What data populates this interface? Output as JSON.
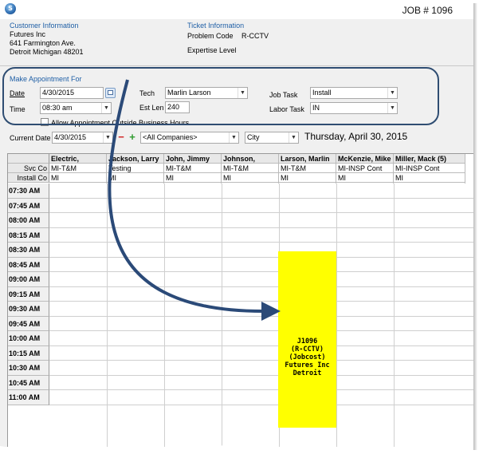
{
  "window": {
    "title": "JOB # 1096",
    "app_icon_letter": "S"
  },
  "customer": {
    "heading": "Customer Information",
    "name": "Futures  Inc",
    "address1": "641 Farmington Ave.",
    "address2": "Detroit Michigan 48201"
  },
  "ticket": {
    "heading": "Ticket Information",
    "problem_code_label": "Problem Code",
    "problem_code": "R-CCTV",
    "expertise_label": "Expertise Level"
  },
  "appointment": {
    "heading": "Make Appointment For",
    "date_label": "Date",
    "date_value": "4/30/2015",
    "time_label": "Time",
    "time_value": "08:30 am",
    "tech_label": "Tech",
    "tech_value": "Marlin Larson",
    "estlen_label": "Est Len",
    "estlen_value": "240",
    "jobtask_label": "Job Task",
    "jobtask_value": "Install",
    "labortask_label": "Labor Task",
    "labortask_value": "IN",
    "allow_outside_label": "Allow Appointment Outside Business Hours"
  },
  "toolbar": {
    "current_date_label": "Current Date",
    "current_date_value": "4/30/2015",
    "minus_label": "−",
    "plus_label": "+",
    "companies_value": "<All Companies>",
    "city_value": "City",
    "date_heading": "Thursday, April 30, 2015"
  },
  "grid": {
    "row_labels": {
      "svc": "Svc Co",
      "install": "Install Co"
    },
    "techs": [
      {
        "name": "Electric,",
        "svc": "MI-T&M",
        "install": "MI"
      },
      {
        "name": "Jackson, Larry",
        "svc": "Testing",
        "install": "MI"
      },
      {
        "name": "John, Jimmy",
        "svc": "MI-T&M",
        "install": "MI"
      },
      {
        "name": "Johnson,",
        "svc": "MI-T&M",
        "install": "MI"
      },
      {
        "name": "Larson, Marlin",
        "svc": "MI-T&M",
        "install": "MI"
      },
      {
        "name": "McKenzie, Mike",
        "svc": "MI-INSP Cont",
        "install": "MI"
      },
      {
        "name": "Miller, Mack (5)",
        "svc": "MI-INSP Cont",
        "install": "MI"
      }
    ],
    "times": [
      "07:30 AM",
      "07:45 AM",
      "08:00 AM",
      "08:15 AM",
      "08:30 AM",
      "08:45 AM",
      "09:00 AM",
      "09:15 AM",
      "09:30 AM",
      "09:45 AM",
      "10:00 AM",
      "10:15 AM",
      "10:30 AM",
      "10:45 AM",
      "11:00 AM"
    ],
    "appointment_block": {
      "line1": "J1096",
      "line2": "(R-CCTV)",
      "line3": "(Jobcost)",
      "line4": "Futures Inc",
      "line5": "Detroit",
      "color": "#ffff00"
    }
  },
  "colors": {
    "accent": "#1f5fa6",
    "callout": "#2f4d72"
  }
}
